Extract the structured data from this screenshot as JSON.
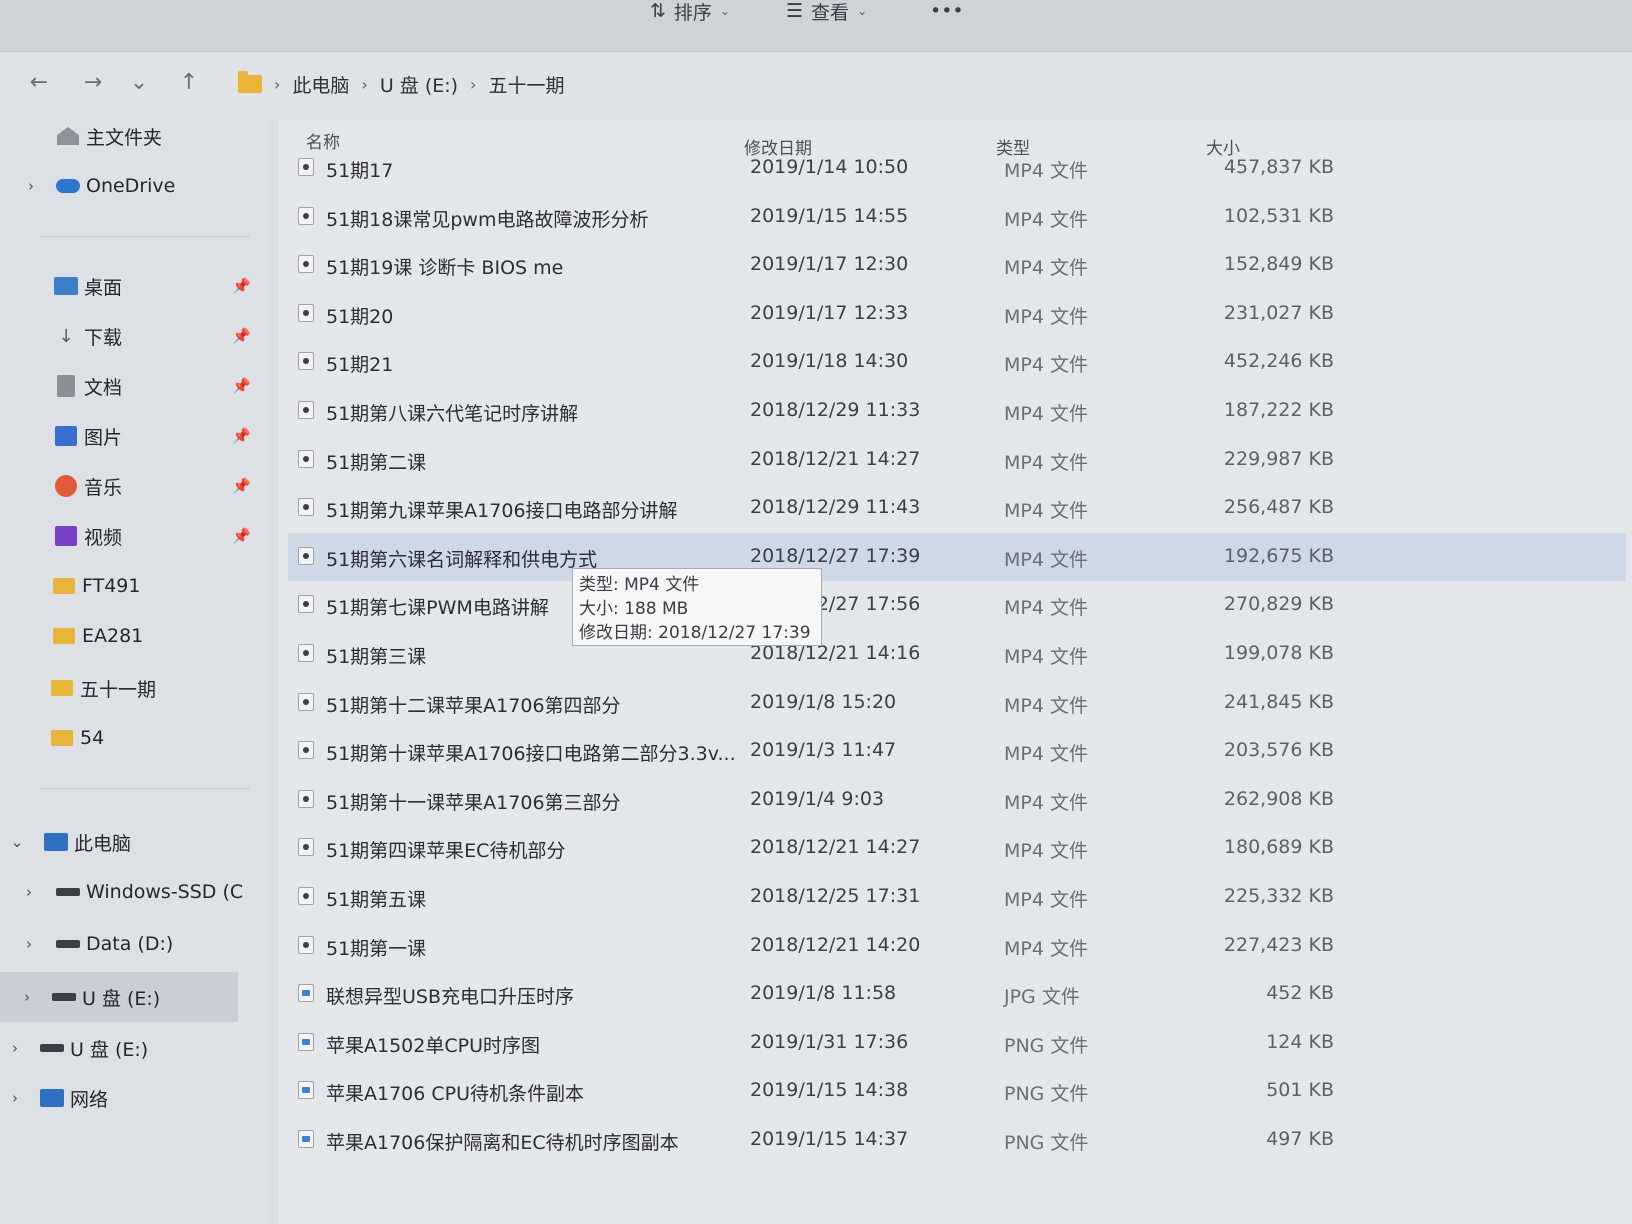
{
  "toolbar": {
    "sort_label": "排序",
    "view_label": "查看",
    "more_label": "•••"
  },
  "nav": {
    "back_icon": "←",
    "forward_icon": "→",
    "recent_icon": "⌄",
    "up_icon": "↑"
  },
  "breadcrumb": {
    "items": [
      "此电脑",
      "U 盘 (E:)",
      "五十一期"
    ]
  },
  "sidebar": {
    "home": "主文件夹",
    "onedrive": "OneDrive",
    "quick": [
      {
        "label": "桌面",
        "icon": "desktop-icon"
      },
      {
        "label": "下载",
        "icon": "download-icon"
      },
      {
        "label": "文档",
        "icon": "document-icon"
      },
      {
        "label": "图片",
        "icon": "pictures-icon"
      },
      {
        "label": "音乐",
        "icon": "music-icon"
      },
      {
        "label": "视频",
        "icon": "video-icon"
      }
    ],
    "folders": [
      "FT491",
      "EA281",
      "五十一期",
      "54"
    ],
    "this_pc": "此电脑",
    "drives": [
      "Windows-SSD (C",
      "Data (D:)",
      "U 盘 (E:)"
    ],
    "usb_again": "U 盘 (E:)",
    "network": "网络"
  },
  "columns": {
    "name": "名称",
    "date": "修改日期",
    "type": "类型",
    "size": "大小"
  },
  "files": [
    {
      "name": "51期17",
      "date": "2019/1/14 10:50",
      "type": "MP4 文件",
      "size": "457,837 KB"
    },
    {
      "name": "51期18课常见pwm电路故障波形分析",
      "date": "2019/1/15 14:55",
      "type": "MP4 文件",
      "size": "102,531 KB"
    },
    {
      "name": "51期19课 诊断卡 BIOS me",
      "date": "2019/1/17 12:30",
      "type": "MP4 文件",
      "size": "152,849 KB"
    },
    {
      "name": "51期20",
      "date": "2019/1/17 12:33",
      "type": "MP4 文件",
      "size": "231,027 KB"
    },
    {
      "name": "51期21",
      "date": "2019/1/18 14:30",
      "type": "MP4 文件",
      "size": "452,246 KB"
    },
    {
      "name": "51期第八课六代笔记时序讲解",
      "date": "2018/12/29 11:33",
      "type": "MP4 文件",
      "size": "187,222 KB"
    },
    {
      "name": "51期第二课",
      "date": "2018/12/21 14:27",
      "type": "MP4 文件",
      "size": "229,987 KB"
    },
    {
      "name": "51期第九课苹果A1706接口电路部分讲解",
      "date": "2018/12/29 11:43",
      "type": "MP4 文件",
      "size": "256,487 KB"
    },
    {
      "name": "51期第六课名词解释和供电方式",
      "date": "2018/12/27 17:39",
      "type": "MP4 文件",
      "size": "192,675 KB"
    },
    {
      "name": "51期第七课PWM电路讲解",
      "date": "2018/12/27 17:56",
      "type": "MP4 文件",
      "size": "270,829 KB"
    },
    {
      "name": "51期第三课",
      "date": "2018/12/21 14:16",
      "type": "MP4 文件",
      "size": "199,078 KB"
    },
    {
      "name": "51期第十二课苹果A1706第四部分",
      "date": "2019/1/8 15:20",
      "type": "MP4 文件",
      "size": "241,845 KB"
    },
    {
      "name": "51期第十课苹果A1706接口电路第二部分3.3v...",
      "date": "2019/1/3 11:47",
      "type": "MP4 文件",
      "size": "203,576 KB"
    },
    {
      "name": "51期第十一课苹果A1706第三部分",
      "date": "2019/1/4 9:03",
      "type": "MP4 文件",
      "size": "262,908 KB"
    },
    {
      "name": "51期第四课苹果EC待机部分",
      "date": "2018/12/21 14:27",
      "type": "MP4 文件",
      "size": "180,689 KB"
    },
    {
      "name": "51期第五课",
      "date": "2018/12/25 17:31",
      "type": "MP4 文件",
      "size": "225,332 KB"
    },
    {
      "name": "51期第一课",
      "date": "2018/12/21 14:20",
      "type": "MP4 文件",
      "size": "227,423 KB"
    },
    {
      "name": "联想异型USB充电口升压时序",
      "date": "2019/1/8 11:58",
      "type": "JPG 文件",
      "size": "452 KB"
    },
    {
      "name": "苹果A1502单CPU时序图",
      "date": "2019/1/31 17:36",
      "type": "PNG 文件",
      "size": "124 KB"
    },
    {
      "name": "苹果A1706 CPU待机条件副本",
      "date": "2019/1/15 14:38",
      "type": "PNG 文件",
      "size": "501 KB"
    },
    {
      "name": "苹果A1706保护隔离和EC待机时序图副本",
      "date": "2019/1/15 14:37",
      "type": "PNG 文件",
      "size": "497 KB"
    }
  ],
  "tooltip": {
    "type_line": "类型: MP4 文件",
    "size_line": "大小: 188 MB",
    "date_line": "修改日期: 2018/12/27 17:39"
  }
}
